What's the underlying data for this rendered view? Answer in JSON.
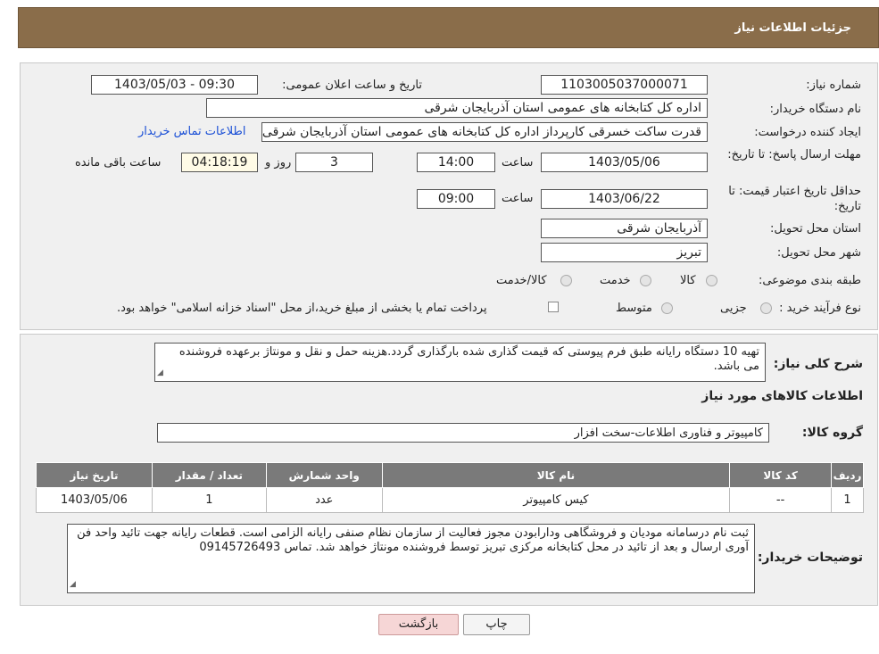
{
  "header": {
    "title": "جزئیات اطلاعات نیاز"
  },
  "need": {
    "number_label": "شماره نیاز:",
    "number_value": "1103005037000071",
    "announce_label": "تاریخ و ساعت اعلان عمومی:",
    "announce_value": "1403/05/03 - 09:30",
    "buyer_label": "نام دستگاه خریدار:",
    "buyer_value": "اداره کل کتابخانه های عمومی استان آذربایجان شرقی",
    "creator_label": "ایجاد کننده درخواست:",
    "creator_value": "قدرت ساکت خسرقی کارپرداز اداره کل کتابخانه های عمومی استان آذربایجان شرقی",
    "contact_link": "اطلاعات تماس خریدار",
    "deadline_label": "مهلت ارسال پاسخ: تا تاریخ:",
    "deadline_date": "1403/05/06",
    "time_label": "ساعت",
    "deadline_time": "14:00",
    "days_value": "3",
    "days_label": "روز و",
    "remaining_value": "04:18:19",
    "remaining_label": "ساعت باقی مانده",
    "validity_label": "حداقل تاریخ اعتبار قیمت: تا تاریخ:",
    "validity_date": "1403/06/22",
    "validity_time": "09:00",
    "province_label": "استان محل تحویل:",
    "province_value": "آذربایجان شرقی",
    "city_label": "شهر محل تحویل:",
    "city_value": "تبریز",
    "category_label": "طبقه بندی موضوعی:",
    "category_options": [
      "کالا",
      "خدمت",
      "کالا/خدمت"
    ],
    "process_label": "نوع فرآیند خرید :",
    "process_options": [
      "جزیی",
      "متوسط"
    ],
    "process_note": "پرداخت تمام یا بخشی از مبلغ خرید،از محل \"اسناد خزانه اسلامی\" خواهد بود."
  },
  "summary": {
    "label": "شرح کلی نیاز:",
    "text": "تهیه 10 دستگاه رایانه طبق فرم پیوستی که قیمت گذاری شده بارگذاری گردد.هزینه حمل و نقل و مونتاژ برعهده فروشنده می باشد."
  },
  "goods": {
    "section_title": "اطلاعات کالاهای مورد نیاز",
    "group_label": "گروه کالا:",
    "group_value": "کامپیوتر و فناوری اطلاعات-سخت افزار",
    "columns": [
      "ردیف",
      "کد کالا",
      "نام کالا",
      "واحد شمارش",
      "تعداد / مقدار",
      "تاریخ نیاز"
    ],
    "rows": [
      [
        "1",
        "--",
        "کیس کامپیوتر",
        "عدد",
        "1",
        "1403/05/06"
      ]
    ]
  },
  "buyer_notes": {
    "label": "توضیحات خریدار:",
    "text": "ثبت نام درسامانه مودیان و فروشگاهی ودارابودن مجوز فعالیت از سازمان نظام صنفی رایانه الزامی است. قطعات رایانه جهت تائید واحد فن آوری ارسال و بعد از تائید در محل کتابخانه مرکزی تبریز توسط فروشنده مونتاژ خواهد شد. تماس 09145726493"
  },
  "actions": {
    "print": "چاپ",
    "back": "بازگشت"
  },
  "colors": {
    "header_bg": "#8a6d4a",
    "table_header_bg": "#7a7a7a",
    "back_button_bg": "#f6d6d6",
    "link": "#1a4fd6"
  }
}
